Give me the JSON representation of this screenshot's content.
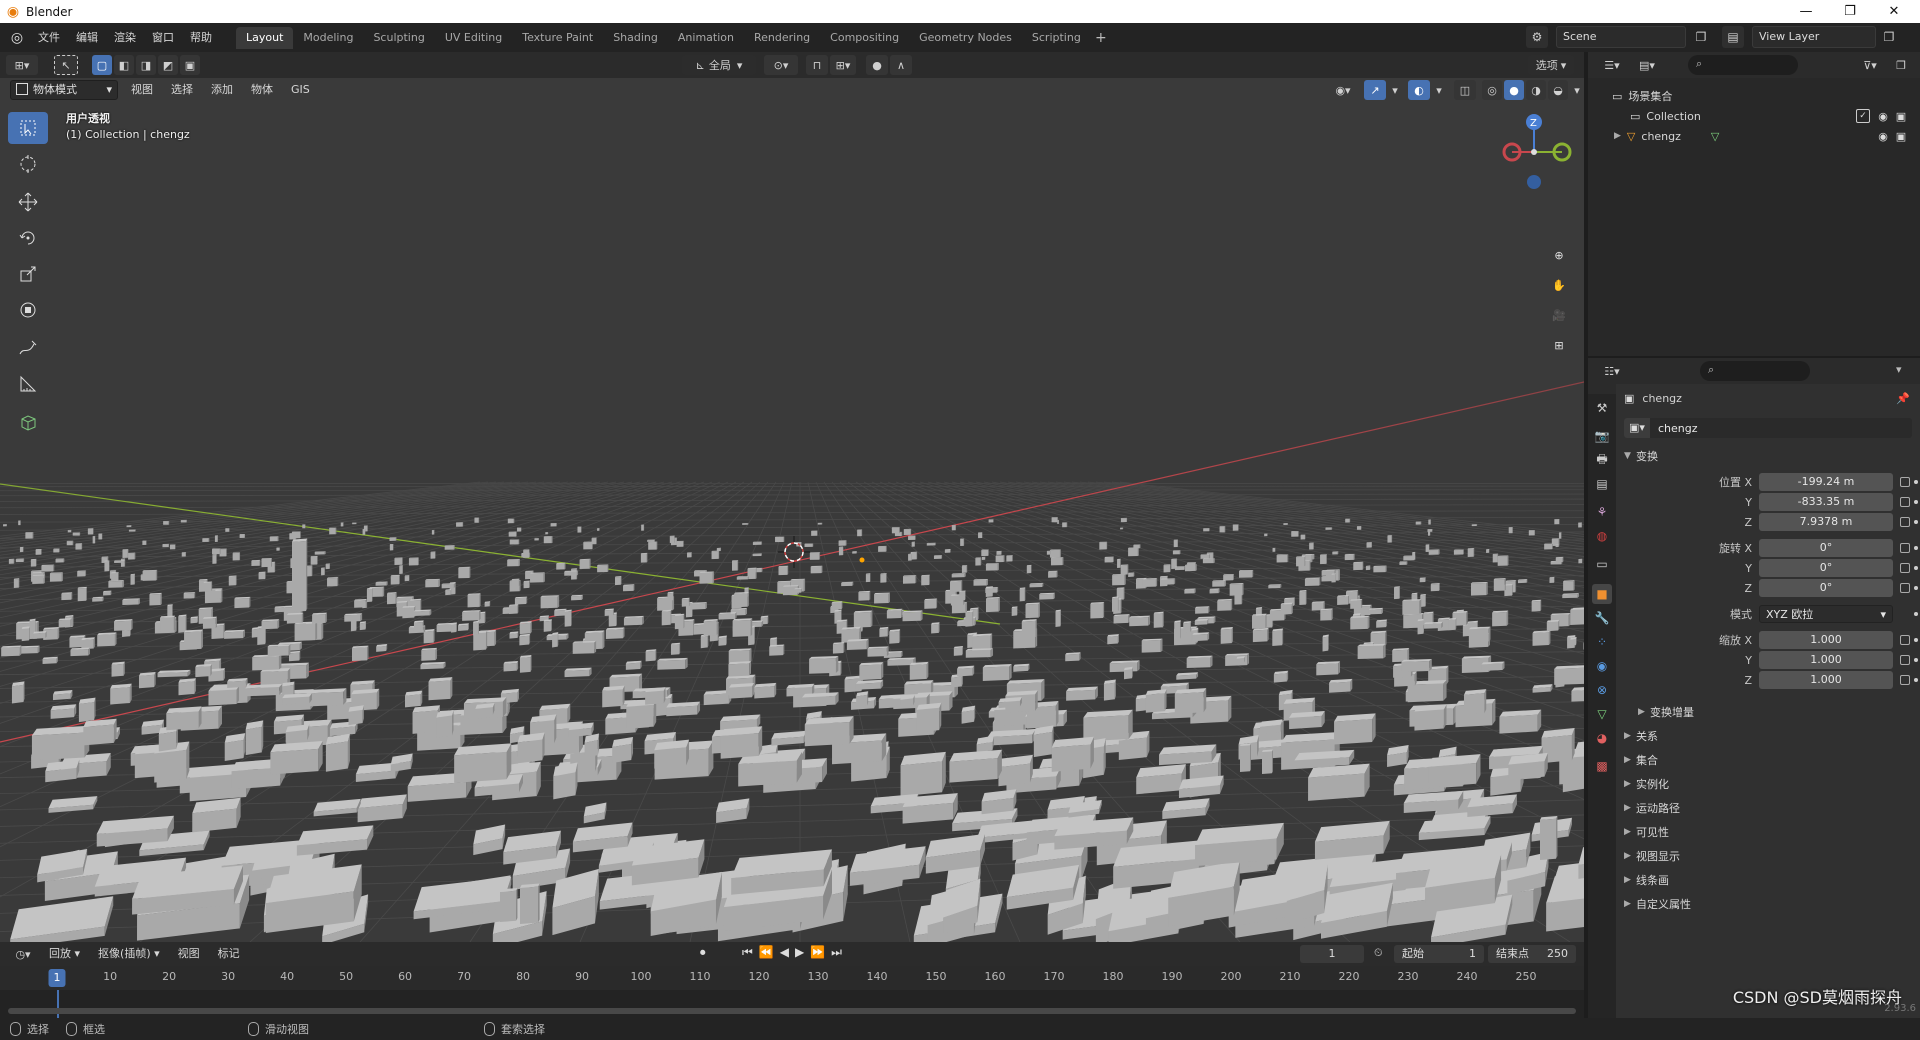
{
  "window": {
    "title": "Blender",
    "controls": [
      "—",
      "❐",
      "✕"
    ]
  },
  "menubar": {
    "items": [
      "文件",
      "编辑",
      "渲染",
      "窗口",
      "帮助"
    ]
  },
  "workspaces": {
    "tabs": [
      "Layout",
      "Modeling",
      "Sculpting",
      "UV Editing",
      "Texture Paint",
      "Shading",
      "Animation",
      "Rendering",
      "Compositing",
      "Geometry Nodes",
      "Scripting"
    ],
    "active": "Layout",
    "add_label": "+"
  },
  "scene": {
    "name": "Scene",
    "view_layer": "View Layer"
  },
  "viewport": {
    "orientation": "全局",
    "options_label": "选项",
    "mode": "物体模式",
    "menus": [
      "视图",
      "选择",
      "添加",
      "物体",
      "GIS"
    ],
    "view_name": "用户透视",
    "collection_info": "(1) Collection | chengz",
    "gizmo_axis_z": "Z",
    "tools": [
      "select-box",
      "cursor",
      "move",
      "rotate",
      "scale",
      "transform",
      "annotate",
      "measure",
      "add-cube"
    ],
    "active_tool": "select-box",
    "colors": {
      "background": "#3a3a3a",
      "grid": "#4a4a4a",
      "x_axis": "#c8474d",
      "y_axis": "#8bb232",
      "building": "#a9a9a9",
      "active_blue": "#4772b3"
    }
  },
  "outliner": {
    "root": "场景集合",
    "items": [
      {
        "name": "Collection",
        "icon": "collection-icon"
      },
      {
        "name": "chengz",
        "icon": "mesh-object-icon"
      }
    ]
  },
  "properties": {
    "object_name": "chengz",
    "data_name": "chengz",
    "transform": {
      "title": "变换",
      "location": {
        "label": "位置 X",
        "x": "-199.24 m",
        "y": "-833.35 m",
        "z": "7.9378 m"
      },
      "rotation": {
        "label": "旋转 X",
        "x": "0°",
        "y": "0°",
        "z": "0°"
      },
      "mode": {
        "label": "模式",
        "value": "XYZ 欧拉"
      },
      "scale": {
        "label": "缩放 X",
        "x": "1.000",
        "y": "1.000",
        "z": "1.000"
      },
      "axis_y": "Y",
      "axis_z": "Z",
      "delta": "变换增量"
    },
    "panels": [
      "关系",
      "集合",
      "实例化",
      "运动路径",
      "可见性",
      "视图显示",
      "线条画",
      "自定义属性"
    ]
  },
  "timeline": {
    "menus": [
      "回放",
      "抠像(插帧)",
      "视图",
      "标记"
    ],
    "current_frame": "1",
    "start_label": "起始",
    "start": "1",
    "end_label": "结束点",
    "end": "250",
    "ticks": [
      "1",
      "10",
      "20",
      "30",
      "40",
      "50",
      "60",
      "70",
      "80",
      "90",
      "100",
      "110",
      "120",
      "130",
      "140",
      "150",
      "160",
      "170",
      "180",
      "190",
      "200",
      "210",
      "220",
      "230",
      "240",
      "250"
    ]
  },
  "statusbar": {
    "items": [
      "选择",
      "框选",
      "滑动视图",
      "套索选择"
    ]
  },
  "watermark": "CSDN @SD莫烟雨探舟",
  "version": "2.93.6"
}
